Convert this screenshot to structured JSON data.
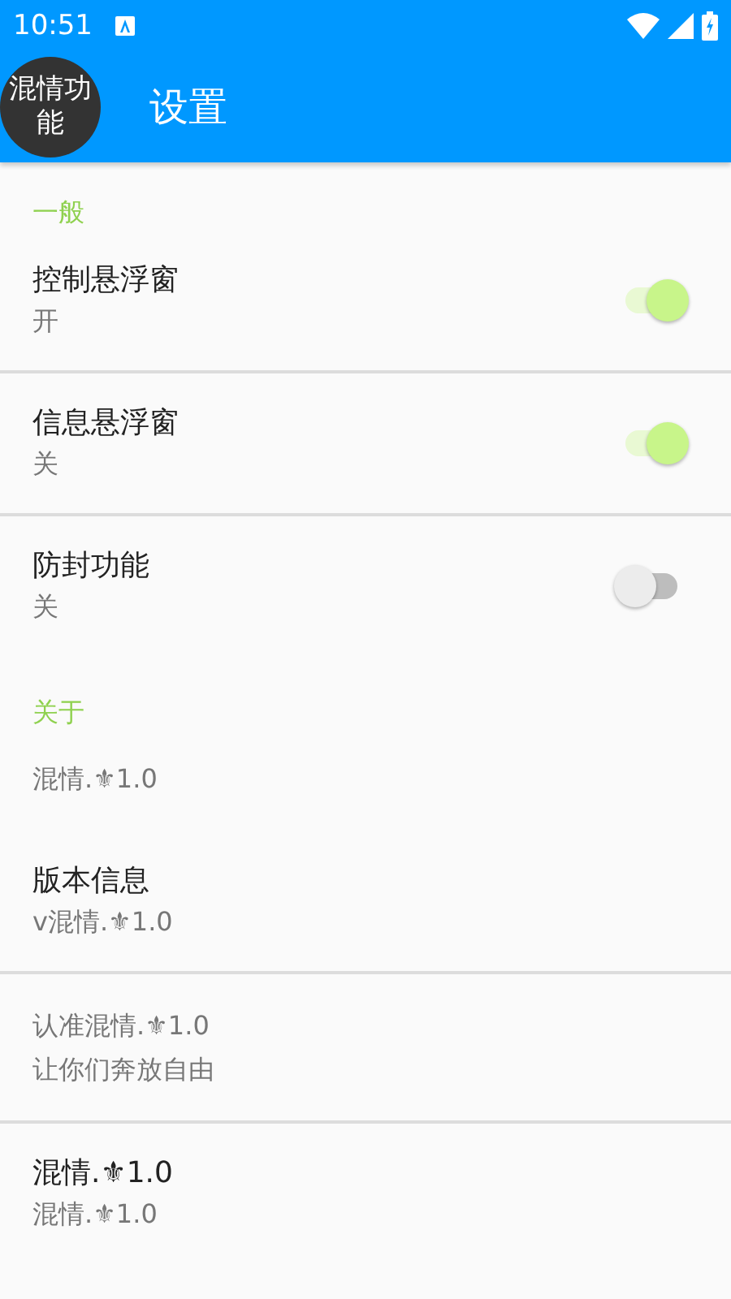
{
  "status_bar": {
    "time": "10:51"
  },
  "toolbar": {
    "avatar_text": "混情功能",
    "title": "设置"
  },
  "sections": [
    {
      "header": "一般",
      "items": [
        {
          "kind": "switch",
          "title": "控制悬浮窗",
          "summary": "开",
          "on": true,
          "divider": true
        },
        {
          "kind": "switch",
          "title": "信息悬浮窗",
          "summary": "关",
          "on": true,
          "divider": true
        },
        {
          "kind": "switch",
          "title": "防封功能",
          "summary": "关",
          "on": false,
          "divider": false
        }
      ]
    },
    {
      "header": "关于",
      "items": [
        {
          "kind": "text",
          "summary": "混情.⚜1.0",
          "divider": false
        },
        {
          "kind": "text",
          "title": "版本信息",
          "summary": "v混情.⚜1.0",
          "divider": true
        },
        {
          "kind": "note",
          "lines": [
            "认准混情.⚜1.0",
            "让你们奔放自由"
          ],
          "divider": true
        },
        {
          "kind": "text",
          "title": "混情.⚜1.0",
          "summary": "混情.⚜1.0"
        }
      ]
    }
  ]
}
